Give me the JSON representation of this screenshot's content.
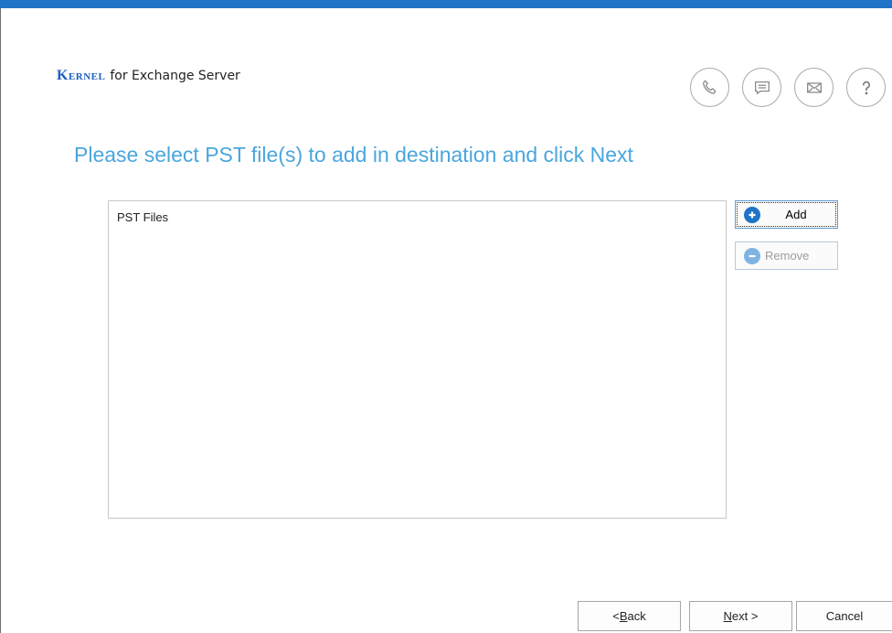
{
  "brand": {
    "name": "Kernel",
    "product": "for Exchange Server"
  },
  "help_icons": [
    "phone-icon",
    "chat-icon",
    "mail-icon",
    "help-icon"
  ],
  "heading": "Please select PST file(s) to add in destination and click Next",
  "file_list": {
    "header": "PST Files",
    "items": []
  },
  "actions": {
    "add_label": "Add",
    "remove_label": "Remove",
    "remove_enabled": false
  },
  "navigation": {
    "back_prefix": "< ",
    "back_key": "B",
    "back_rest": "ack",
    "next_key": "N",
    "next_rest": "ext >",
    "cancel_label": "Cancel"
  },
  "colors": {
    "accent_bar": "#1f74c7",
    "heading": "#4aa6dd",
    "brand": "#1f5fbf"
  }
}
